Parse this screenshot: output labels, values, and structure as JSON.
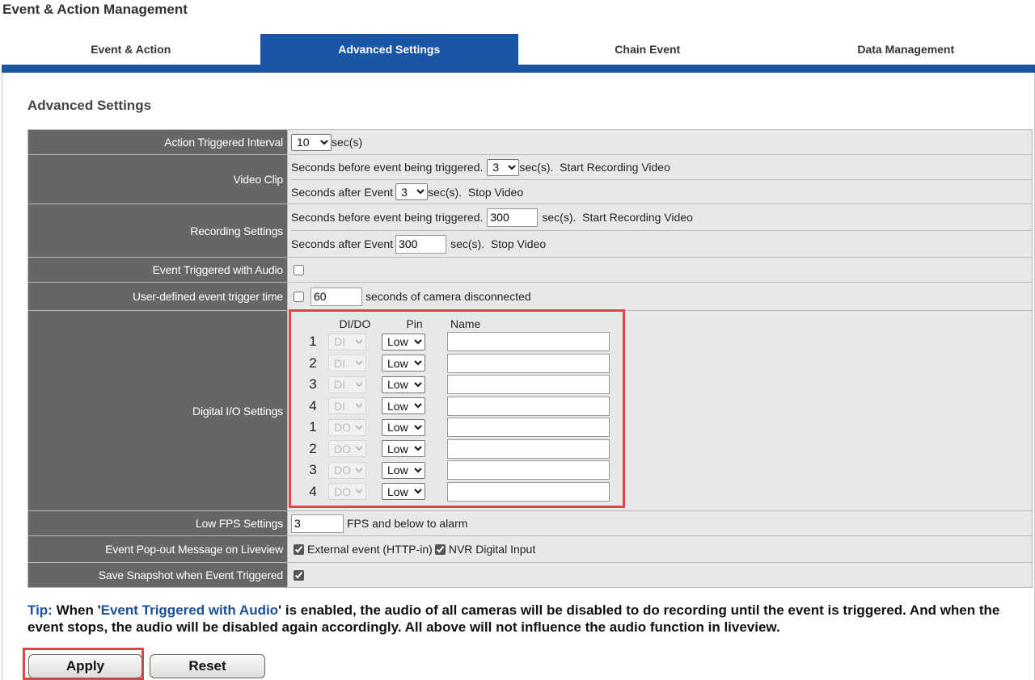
{
  "app_title": "Event & Action Management",
  "tabs": [
    {
      "label": "Event & Action",
      "active": false
    },
    {
      "label": "Advanced Settings",
      "active": true
    },
    {
      "label": "Chain Event",
      "active": false
    },
    {
      "label": "Data Management",
      "active": false
    }
  ],
  "section_title": "Advanced Settings",
  "rows": {
    "action_interval": {
      "label": "Action Triggered Interval",
      "value": "10",
      "unit": "sec(s)"
    },
    "video_clip": {
      "label": "Video Clip",
      "before_text": "Seconds before event being triggered.",
      "before_value": "3",
      "before_suffix": "sec(s).  Start Recording Video",
      "after_text": "Seconds after Event",
      "after_value": "3",
      "after_suffix": "sec(s).  Stop Video"
    },
    "recording": {
      "label": "Recording Settings",
      "before_text": "Seconds before event being triggered.",
      "before_value": "300",
      "before_suffix": "sec(s).  Start Recording Video",
      "after_text": "Seconds after Event",
      "after_value": "300",
      "after_suffix": "sec(s).  Stop Video"
    },
    "audio": {
      "label": "Event Triggered with Audio",
      "checked": false
    },
    "user_defined": {
      "label": "User-defined event trigger time",
      "checked": false,
      "value": "60",
      "suffix": "seconds of camera disconnected"
    },
    "digital_io": {
      "label": "Digital I/O Settings",
      "headers": {
        "dido": "DI/DO",
        "pin": "Pin",
        "name": "Name"
      },
      "entries": [
        {
          "num": "1",
          "type": "DI",
          "pin": "Low",
          "name": ""
        },
        {
          "num": "2",
          "type": "DI",
          "pin": "Low",
          "name": ""
        },
        {
          "num": "3",
          "type": "DI",
          "pin": "Low",
          "name": ""
        },
        {
          "num": "4",
          "type": "DI",
          "pin": "Low",
          "name": ""
        },
        {
          "num": "1",
          "type": "DO",
          "pin": "Low",
          "name": ""
        },
        {
          "num": "2",
          "type": "DO",
          "pin": "Low",
          "name": ""
        },
        {
          "num": "3",
          "type": "DO",
          "pin": "Low",
          "name": ""
        },
        {
          "num": "4",
          "type": "DO",
          "pin": "Low",
          "name": ""
        }
      ]
    },
    "low_fps": {
      "label": "Low FPS Settings",
      "value": "3",
      "suffix": "FPS and below to alarm"
    },
    "popout": {
      "label": "Event Pop-out Message on Liveview",
      "external_label": "External event (HTTP-in)",
      "external_checked": true,
      "nvr_label": "NVR Digital Input",
      "nvr_checked": true
    },
    "snapshot": {
      "label": "Save Snapshot when Event Triggered",
      "checked": true
    }
  },
  "tip": {
    "label": "Tip:",
    "pre": " When '",
    "highlight": "Event Triggered with Audio",
    "post": "' is enabled, the audio of all cameras will be disabled to do recording until the event is triggered. And when the event stops, the audio will be disabled again accordingly. All above will not influence the audio function in liveview."
  },
  "buttons": {
    "apply": "Apply",
    "reset": "Reset"
  },
  "colors": {
    "accent": "#1a56a4",
    "label_bg": "#666666",
    "value_bg": "#e8e8eb",
    "highlight_border": "#e04545"
  }
}
